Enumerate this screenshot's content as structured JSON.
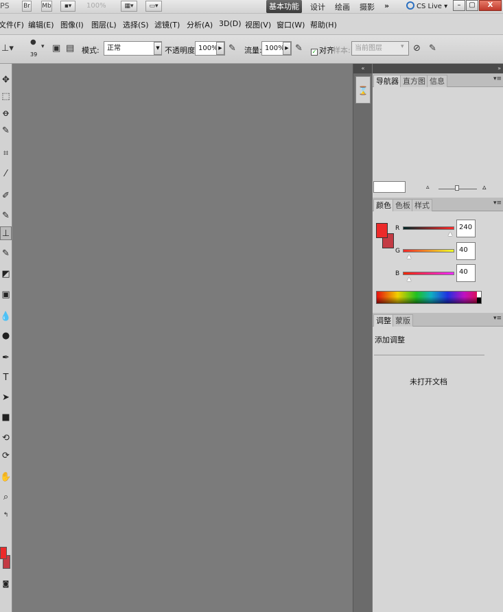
{
  "appbar": {
    "ps_label": "PS",
    "bridge": "Br",
    "mini_bridge": "Mb",
    "zoom": "100%",
    "workspaces": [
      "基本功能",
      "设计",
      "绘画",
      "摄影"
    ],
    "more": "»",
    "cs_live": "CS Live ▾",
    "minimize": "–",
    "maximize": "▢",
    "close": "X"
  },
  "menubar": {
    "items": [
      "文件(F)",
      "编辑(E)",
      "图像(I)",
      "图层(L)",
      "选择(S)",
      "滤镜(T)",
      "分析(A)",
      "3D(D)",
      "视图(V)",
      "窗口(W)",
      "帮助(H)"
    ]
  },
  "options": {
    "brush_size": "39",
    "mode_label": "模式:",
    "mode_value": "正常",
    "opacity_label": "不透明度:",
    "opacity_value": "100%",
    "flow_label": "流量:",
    "flow_value": "100%",
    "aligned_label": "对齐",
    "sample_label": "样本:",
    "sample_value": "当前图层"
  },
  "navigator_panel": {
    "tabs": [
      "导航器",
      "直方图",
      "信息"
    ]
  },
  "color_panel": {
    "tabs": [
      "颜色",
      "色板",
      "样式"
    ],
    "r_label": "R",
    "g_label": "G",
    "b_label": "B",
    "r": "240",
    "g": "40",
    "b": "40",
    "foreground": "#ec2a2a",
    "background": "#c33b44"
  },
  "adjustments_panel": {
    "tabs": [
      "调整",
      "蒙版"
    ],
    "title": "添加调整",
    "message": "未打开文档"
  }
}
